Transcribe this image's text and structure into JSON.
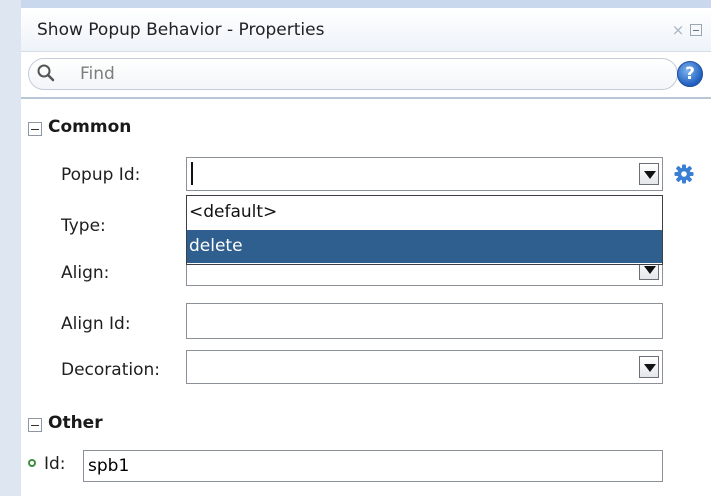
{
  "window": {
    "title": "Show Popup Behavior - Properties",
    "close_glyph": "×",
    "help_glyph": "?"
  },
  "search": {
    "placeholder": "Find",
    "value": ""
  },
  "sections": {
    "common": {
      "title": "Common",
      "fields": {
        "popup_id": {
          "label": "Popup Id:",
          "value": ""
        },
        "type": {
          "label": "Type:",
          "value": ""
        },
        "align": {
          "label": "Align:",
          "value": ""
        },
        "align_id": {
          "label": "Align Id:",
          "value": ""
        },
        "decoration": {
          "label": "Decoration:",
          "value": ""
        }
      },
      "popup_options": [
        {
          "label": "<default>",
          "selected": false
        },
        {
          "label": "delete",
          "selected": true
        }
      ]
    },
    "other": {
      "title": "Other",
      "fields": {
        "id": {
          "label": "Id:",
          "value": "spb1"
        }
      }
    }
  },
  "colors": {
    "selection": "#2f5f8f",
    "panel_edge": "#dde6f1",
    "help_icon": "#1f5fbf",
    "gear_icon": "#3b7fd4",
    "required_marker": "#3e8f3e"
  },
  "icons": [
    "search-icon",
    "help-icon",
    "close-icon",
    "minimize-icon",
    "gear-icon",
    "collapse-icon",
    "chevron-down-icon"
  ]
}
